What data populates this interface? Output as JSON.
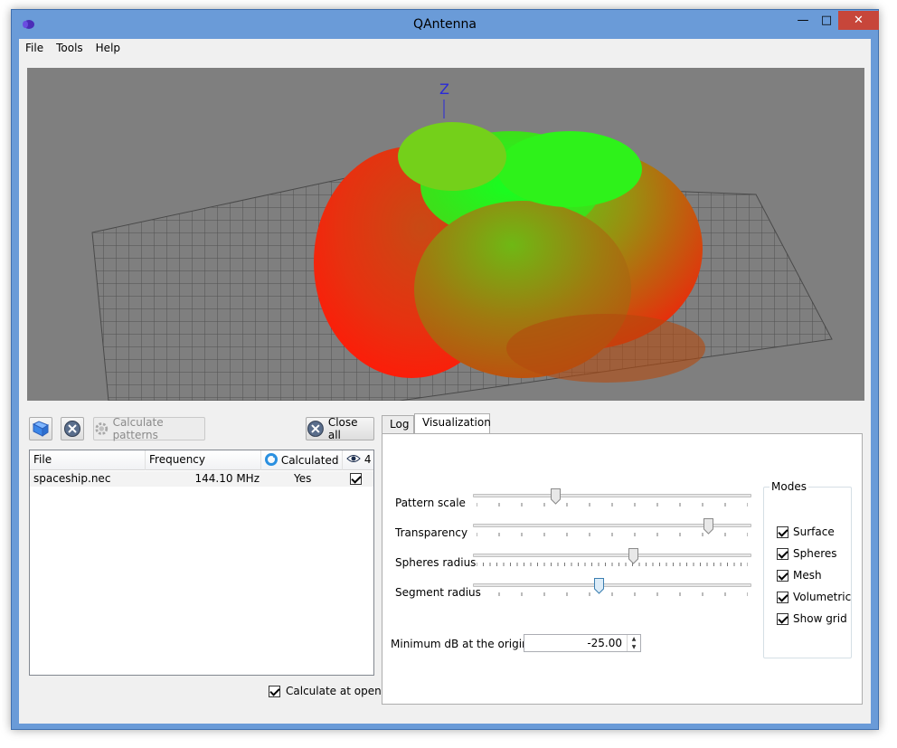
{
  "window": {
    "title": "QAntenna"
  },
  "menu": [
    "File",
    "Tools",
    "Help"
  ],
  "viewport": {
    "axis_label": "Z"
  },
  "toolbar": {
    "calculate_label": "Calculate patterns",
    "close_all_label": "Close all"
  },
  "table": {
    "headers": {
      "file": "File",
      "frequency": "Frequency",
      "calculated": "Calculated",
      "visible": "4"
    },
    "rows": [
      {
        "file": "spaceship.nec",
        "frequency": "144.10 MHz",
        "calculated": "Yes",
        "visible": true
      }
    ]
  },
  "calc_at_opening_label": "Calculate at opening",
  "tabs": {
    "log": "Log",
    "visualization": "Visualization"
  },
  "visualization": {
    "sliders": [
      {
        "label": "Pattern scale",
        "value": 0.29
      },
      {
        "label": "Transparency",
        "value": 0.86
      },
      {
        "label": "Spheres radius",
        "value": 0.58
      },
      {
        "label": "Segment radius",
        "value": 0.45
      }
    ],
    "min_db_label": "Minimum dB at the origin",
    "min_db_value": "-25.00",
    "modes_title": "Modes",
    "modes": [
      {
        "label": "Surface",
        "checked": true
      },
      {
        "label": "Spheres",
        "checked": true
      },
      {
        "label": "Mesh",
        "checked": true
      },
      {
        "label": "Volumetric",
        "checked": true
      },
      {
        "label": "Show grid",
        "checked": true
      }
    ]
  }
}
